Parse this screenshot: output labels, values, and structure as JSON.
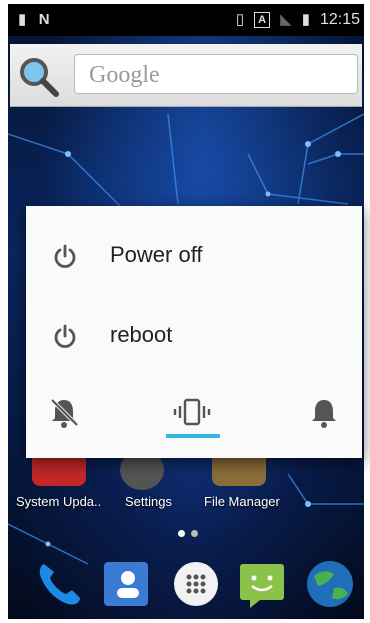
{
  "status_bar": {
    "left_icons": [
      "sim-icon",
      "n-icon"
    ],
    "right_icons": [
      "vibrate-icon",
      "a-icon",
      "no-signal-icon",
      "battery-icon"
    ],
    "a_label": "A",
    "time": "12:15"
  },
  "search_widget": {
    "placeholder": "Google",
    "icon": "magnifier-icon"
  },
  "desktop_apps": [
    {
      "label": "System Upda..",
      "icon": "system-update-icon"
    },
    {
      "label": "Settings",
      "icon": "settings-icon"
    },
    {
      "label": "File Manager",
      "icon": "file-manager-icon"
    }
  ],
  "dock": [
    {
      "icon": "phone-icon"
    },
    {
      "icon": "contacts-icon"
    },
    {
      "icon": "app-drawer-icon"
    },
    {
      "icon": "messaging-icon"
    },
    {
      "icon": "browser-icon"
    }
  ],
  "power_menu": {
    "items": [
      {
        "label": "Power off",
        "icon": "power-icon"
      },
      {
        "label": "reboot",
        "icon": "power-icon"
      }
    ],
    "sound_modes": [
      {
        "name": "silent",
        "icon": "bell-off-icon",
        "selected": false
      },
      {
        "name": "vibrate",
        "icon": "vibrate-icon",
        "selected": true
      },
      {
        "name": "sound",
        "icon": "bell-icon",
        "selected": false
      }
    ],
    "accent_color": "#33b5e5"
  }
}
